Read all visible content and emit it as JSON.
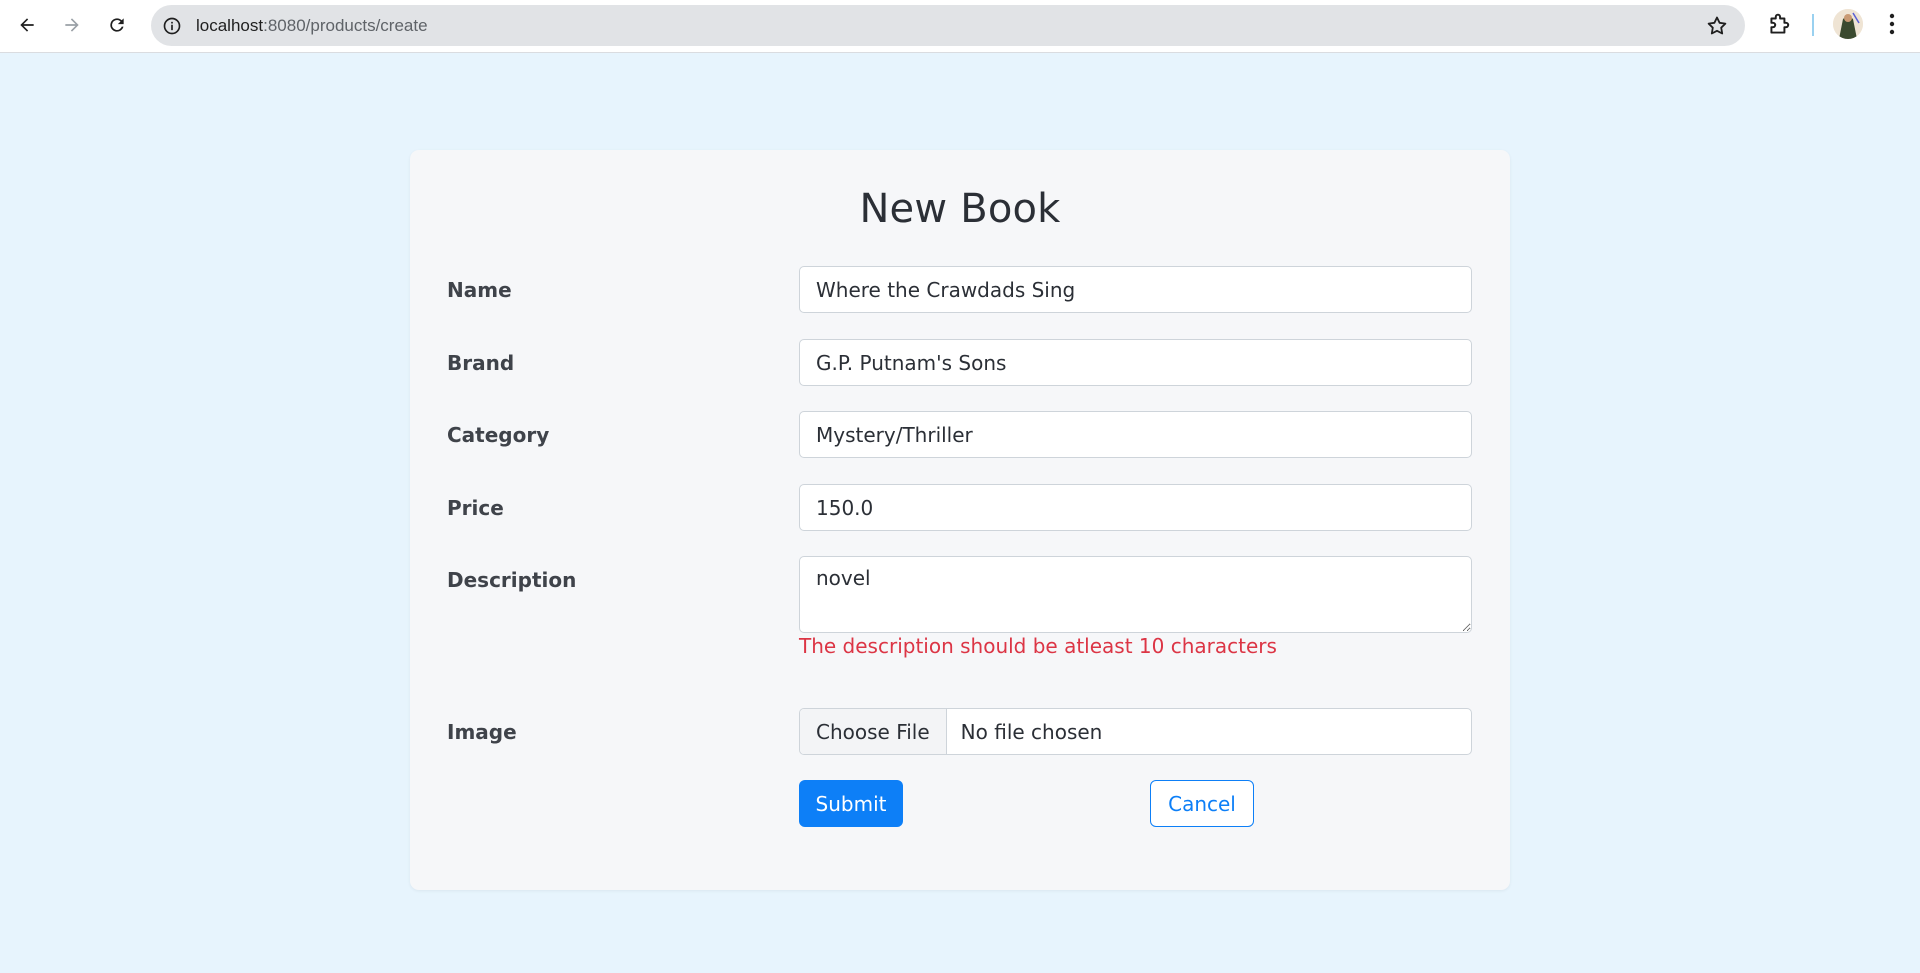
{
  "browser": {
    "url_host": "localhost",
    "url_path": ":8080/products/create"
  },
  "form": {
    "title": "New Book",
    "fields": {
      "name": {
        "label": "Name",
        "value": "Where the Crawdads Sing"
      },
      "brand": {
        "label": "Brand",
        "value": "G.P. Putnam's Sons"
      },
      "category": {
        "label": "Category",
        "value": "Mystery/Thriller"
      },
      "price": {
        "label": "Price",
        "value": "150.0"
      },
      "description": {
        "label": "Description",
        "value": "novel",
        "error": "The description should be atleast 10 characters"
      },
      "image": {
        "label": "Image",
        "button": "Choose File",
        "status": "No file chosen"
      }
    },
    "submit_label": "Submit",
    "cancel_label": "Cancel"
  },
  "colors": {
    "page_background": "#e7f4fd",
    "card_background": "#f6f7f9",
    "primary": "#0d7ff7",
    "error": "#dc3545"
  }
}
